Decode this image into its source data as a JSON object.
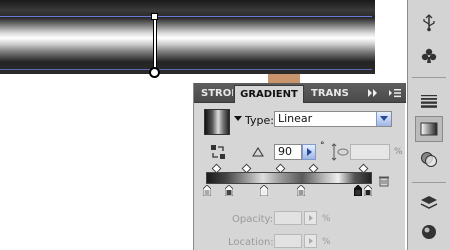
{
  "panel": {
    "tabs": {
      "stroke": "STROKE",
      "gradient": "GRADIENT",
      "transparency": "TRANSPARENCY",
      "collapse_icon": "double-chevron-right-icon",
      "menu_icon": "panel-menu-icon"
    },
    "type_label": "Type:",
    "type_value": "Linear",
    "angle_value": "90",
    "angle_degree_symbol": "°",
    "aspect_percent_symbol": "%",
    "opacity_label": "Opacity:",
    "location_label": "Location:",
    "opacity_percent_symbol": "%",
    "location_percent_symbol": "%"
  },
  "colors": {
    "selection_blue": "#6a78d8",
    "panel_bg": "#d6d6d6",
    "dropdown_accent": "#9fb6e6"
  },
  "tools": [
    "usb-icon",
    "club-icon",
    "stroke-icon",
    "gradient-icon",
    "transparency-icon",
    "layers-icon",
    "appearance-icon"
  ]
}
